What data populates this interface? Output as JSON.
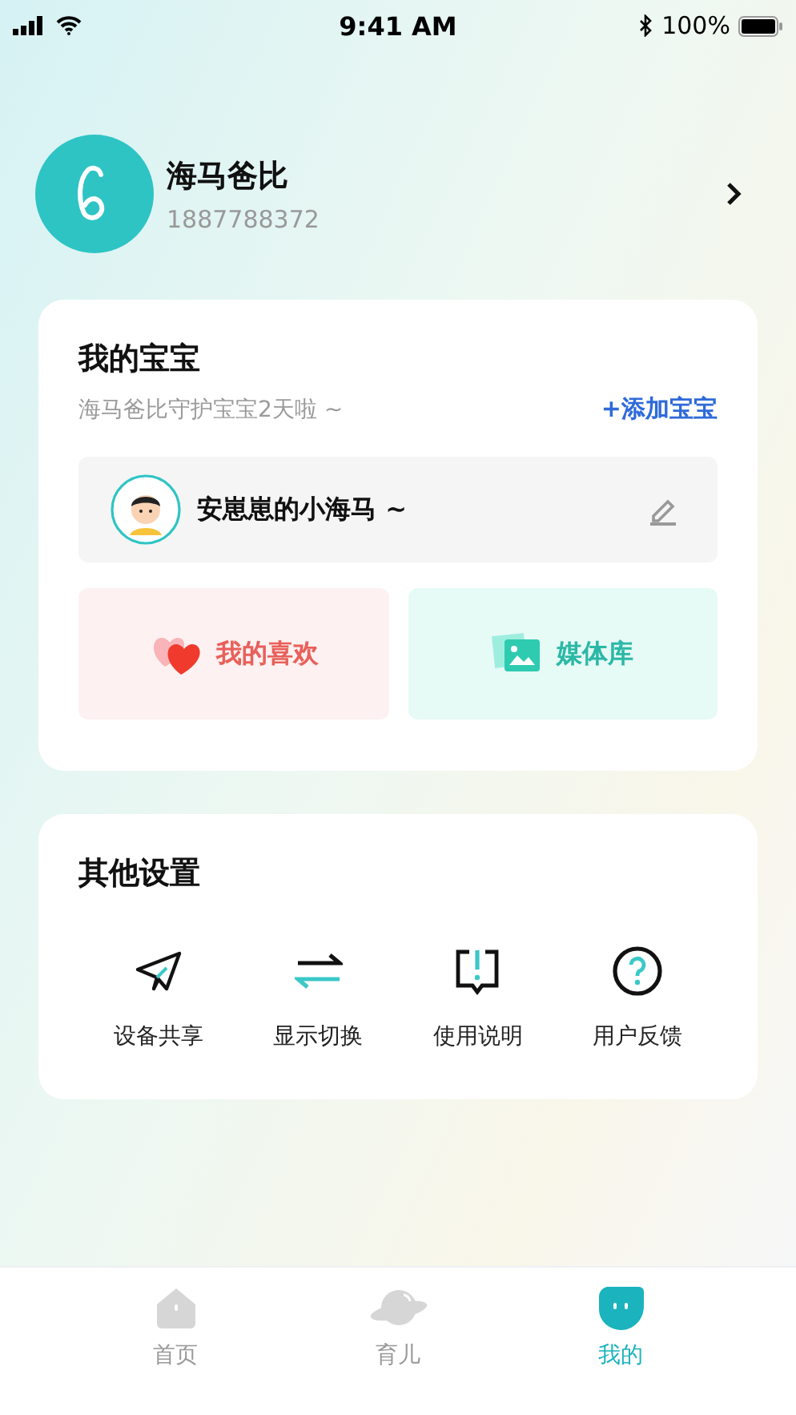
{
  "status_bar": {
    "time": "9:41 AM",
    "battery": "100%"
  },
  "profile": {
    "name": "海马爸比",
    "phone": "1887788372"
  },
  "baby_card": {
    "title": "我的宝宝",
    "subtitle": "海马爸比守护宝宝2天啦 ~",
    "add_link": "+添加宝宝",
    "baby_name": "安崽崽的小海马 ~",
    "tiles": [
      {
        "kind": "favorites",
        "label": "我的喜欢"
      },
      {
        "kind": "media",
        "label": "媒体库"
      }
    ]
  },
  "settings": {
    "title": "其他设置",
    "items": [
      {
        "kind": "share",
        "label": "设备共享"
      },
      {
        "kind": "switch",
        "label": "显示切换"
      },
      {
        "kind": "manual",
        "label": "使用说明"
      },
      {
        "kind": "feedback",
        "label": "用户反馈"
      }
    ]
  },
  "tab_bar": [
    {
      "kind": "home",
      "label": "首页",
      "selected": false
    },
    {
      "kind": "parenting",
      "label": "育儿",
      "selected": false
    },
    {
      "kind": "mine",
      "label": "我的",
      "selected": true
    }
  ]
}
